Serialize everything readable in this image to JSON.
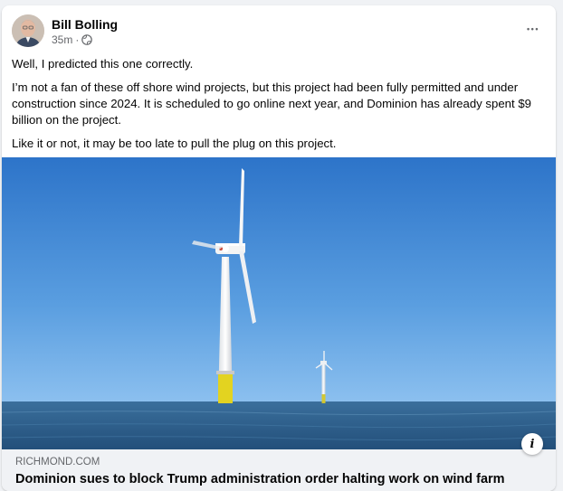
{
  "post": {
    "author": "Bill Bolling",
    "time": "35m",
    "separator": "·",
    "audience_icon": "globe-icon",
    "more_label": "•••",
    "paragraphs": [
      "Well, I predicted this one correctly.",
      "I’m not a fan of these off shore wind projects, but this project had been fully permitted and under construction since 2024. It is scheduled to go online next year, and Dominion has already spent $9 billion on the project.",
      "Like it or not, it may be too late to pull the plug on this project."
    ]
  },
  "link": {
    "domain": "RICHMOND.COM",
    "title": "Dominion sues to block Trump administration order halting work on wind farm",
    "info_label": "i"
  },
  "colors": {
    "sky_top": "#2f78cc",
    "sky_bottom": "#7fb6ea",
    "sea": "#2c5f8c",
    "turbine_base": "#e3d320",
    "card_bg": "#ffffff",
    "link_bg": "#f0f2f5",
    "secondary_text": "#65676b"
  }
}
